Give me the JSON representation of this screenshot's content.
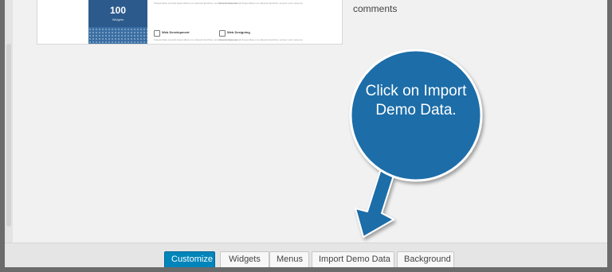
{
  "preview": {
    "stat_number": "100",
    "stat_unit": "Widgets",
    "services": [
      {
        "title": "",
        "desc": "Suspendisse suscipit luspendisse nec placerat\nfaucibus, semper enim posuere."
      },
      {
        "title": "",
        "desc": "Suspendisse suscipit luspendisse nec placerat\nfaucibus, semper enim posuere."
      },
      {
        "title": "Web Development",
        "desc": "Suspendisse suscipit luspendisse nec placerat\nfaucibus, semper enim posuere."
      },
      {
        "title": "Web Designing",
        "desc": "Suspendisse suscipit luspendisse nec placerat\nfaucibus, semper enim posuere."
      }
    ]
  },
  "sidebar_text": {
    "comments": "comments"
  },
  "callout": {
    "text": "Click on Import Demo Data.",
    "color": "#1a6da8"
  },
  "toolbar": {
    "buttons": [
      {
        "label": "Customize",
        "primary": true
      },
      {
        "label": "Widgets",
        "primary": false
      },
      {
        "label": "Menus",
        "primary": false
      },
      {
        "label": "Import Demo Data",
        "primary": false
      },
      {
        "label": "Background",
        "primary": false
      }
    ]
  }
}
